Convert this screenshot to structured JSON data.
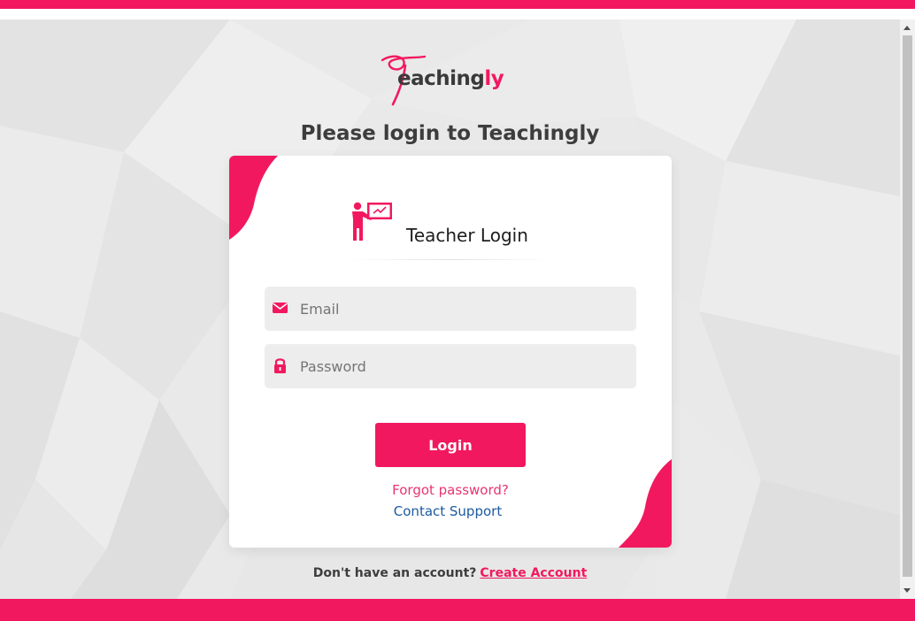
{
  "brand": {
    "logo_prefix": "eaching",
    "logo_accent": "ly",
    "accent_color": "#f2185f"
  },
  "page_title": "Please login to Teachingly",
  "login_card": {
    "heading": "Teacher Login",
    "heading_icon": "teacher-board-icon",
    "email_placeholder": "Email",
    "email_icon": "envelope-icon",
    "password_placeholder": "Password",
    "password_icon": "lock-icon",
    "login_label": "Login",
    "forgot_label": "Forgot password?",
    "support_label": "Contact Support"
  },
  "signup": {
    "prompt": "Don't have an account?",
    "link_label": "Create Account"
  }
}
